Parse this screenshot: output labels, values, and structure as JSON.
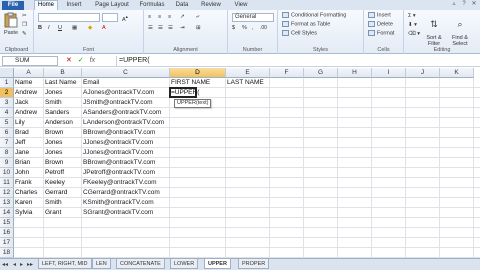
{
  "ribbon": {
    "tabs": [
      "File",
      "Home",
      "Insert",
      "Page Layout",
      "Formulas",
      "Data",
      "Review",
      "View"
    ],
    "active_tab": "Home",
    "groups": {
      "clipboard": "Clipboard",
      "font": "Font",
      "alignment": "Alignment",
      "number": "Number",
      "styles": "Styles",
      "cells": "Cells",
      "editing": "Editing"
    },
    "paste_label": "Paste",
    "number_format": "General",
    "styles_items": [
      "Conditional Formatting",
      "Format as Table",
      "Cell Styles"
    ],
    "cells_items": [
      "Insert",
      "Delete",
      "Format"
    ],
    "editing_items": [
      "Sort &\nFilter",
      "Find &\nSelect"
    ]
  },
  "formula_bar": {
    "name_box": "SUM",
    "fx": "fx",
    "formula": "=UPPER("
  },
  "columns": [
    "A",
    "B",
    "C",
    "D",
    "E",
    "F",
    "G",
    "H",
    "I",
    "J",
    "K"
  ],
  "selected_column": "D",
  "selected_row": "2",
  "rows": [
    "1",
    "2",
    "3",
    "4",
    "5",
    "6",
    "7",
    "8",
    "9",
    "10",
    "11",
    "12",
    "13",
    "14",
    "15",
    "16",
    "17",
    "18"
  ],
  "headers": [
    "Name",
    "Last Name",
    "Email",
    "FIRST NAME",
    "LAST NAME"
  ],
  "data_rows": [
    [
      "Andrew",
      "Jones",
      "AJones@ontrackTV.com"
    ],
    [
      "Jack",
      "Smith",
      "JSmith@ontrackTV.com"
    ],
    [
      "Andrew",
      "Sanders",
      "ASanders@ontrackTV.com"
    ],
    [
      "Lily",
      "Anderson",
      "LAnderson@ontrackTV.com"
    ],
    [
      "Brad",
      "Brown",
      "BBrown@ontrackTV.com"
    ],
    [
      "Jeff",
      "Jones",
      "JJones@ontrackTV.com"
    ],
    [
      "Jane",
      "Jones",
      "JJones@ontrackTV.com"
    ],
    [
      "Brian",
      "Brown",
      "BBrown@ontrackTV.com"
    ],
    [
      "John",
      "Petroff",
      "JPetroff@ontrackTV.com"
    ],
    [
      "Frank",
      "Keeley",
      "FKeeley@ontrackTV.com"
    ],
    [
      "Charles",
      "Gerrard",
      "CGerrard@ontrackTV.com"
    ],
    [
      "Karen",
      "Smith",
      "KSmith@ontrackTV.com"
    ],
    [
      "Sylvia",
      "Grant",
      "SGrant@ontrackTV.com"
    ]
  ],
  "active_cell_value": "=UPPER(",
  "tooltip": "UPPER(text)",
  "sheet_tabs": [
    "LEFT, RIGHT, MID",
    "LEN",
    "CONCATENATE",
    "LOWER",
    "UPPER",
    "PROPER"
  ],
  "active_sheet": "UPPER",
  "colors": {
    "accent": "#2a62b0",
    "selected_header": "#f1c15f"
  }
}
